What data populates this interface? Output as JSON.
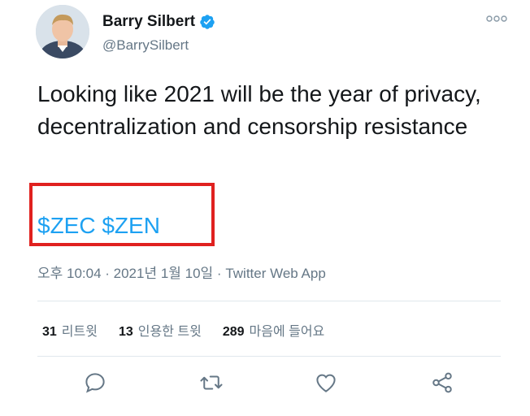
{
  "author": {
    "display_name": "Barry Silbert",
    "handle": "@BarrySilbert",
    "verified": true
  },
  "tweet": {
    "text": "Looking like 2021 will be the year of privacy, decentralization and censorship resistance",
    "cashtags": [
      "$ZEC",
      "$ZEN"
    ],
    "timestamp": "오후 10:04 · 2021년 1월 10일",
    "separator": " · ",
    "source": "Twitter Web App"
  },
  "stats": {
    "retweets_count": "31",
    "retweets_label": "리트윗",
    "quotes_count": "13",
    "quotes_label": "인용한 트윗",
    "likes_count": "289",
    "likes_label": "마음에 들어요"
  },
  "colors": {
    "link": "#1da1f2",
    "verified": "#1da1f2",
    "highlight": "#e0211f",
    "secondary_text": "#657786"
  },
  "icons": [
    "verified-badge-icon",
    "more-options-icon",
    "reply-icon",
    "retweet-icon",
    "like-icon",
    "share-icon"
  ]
}
